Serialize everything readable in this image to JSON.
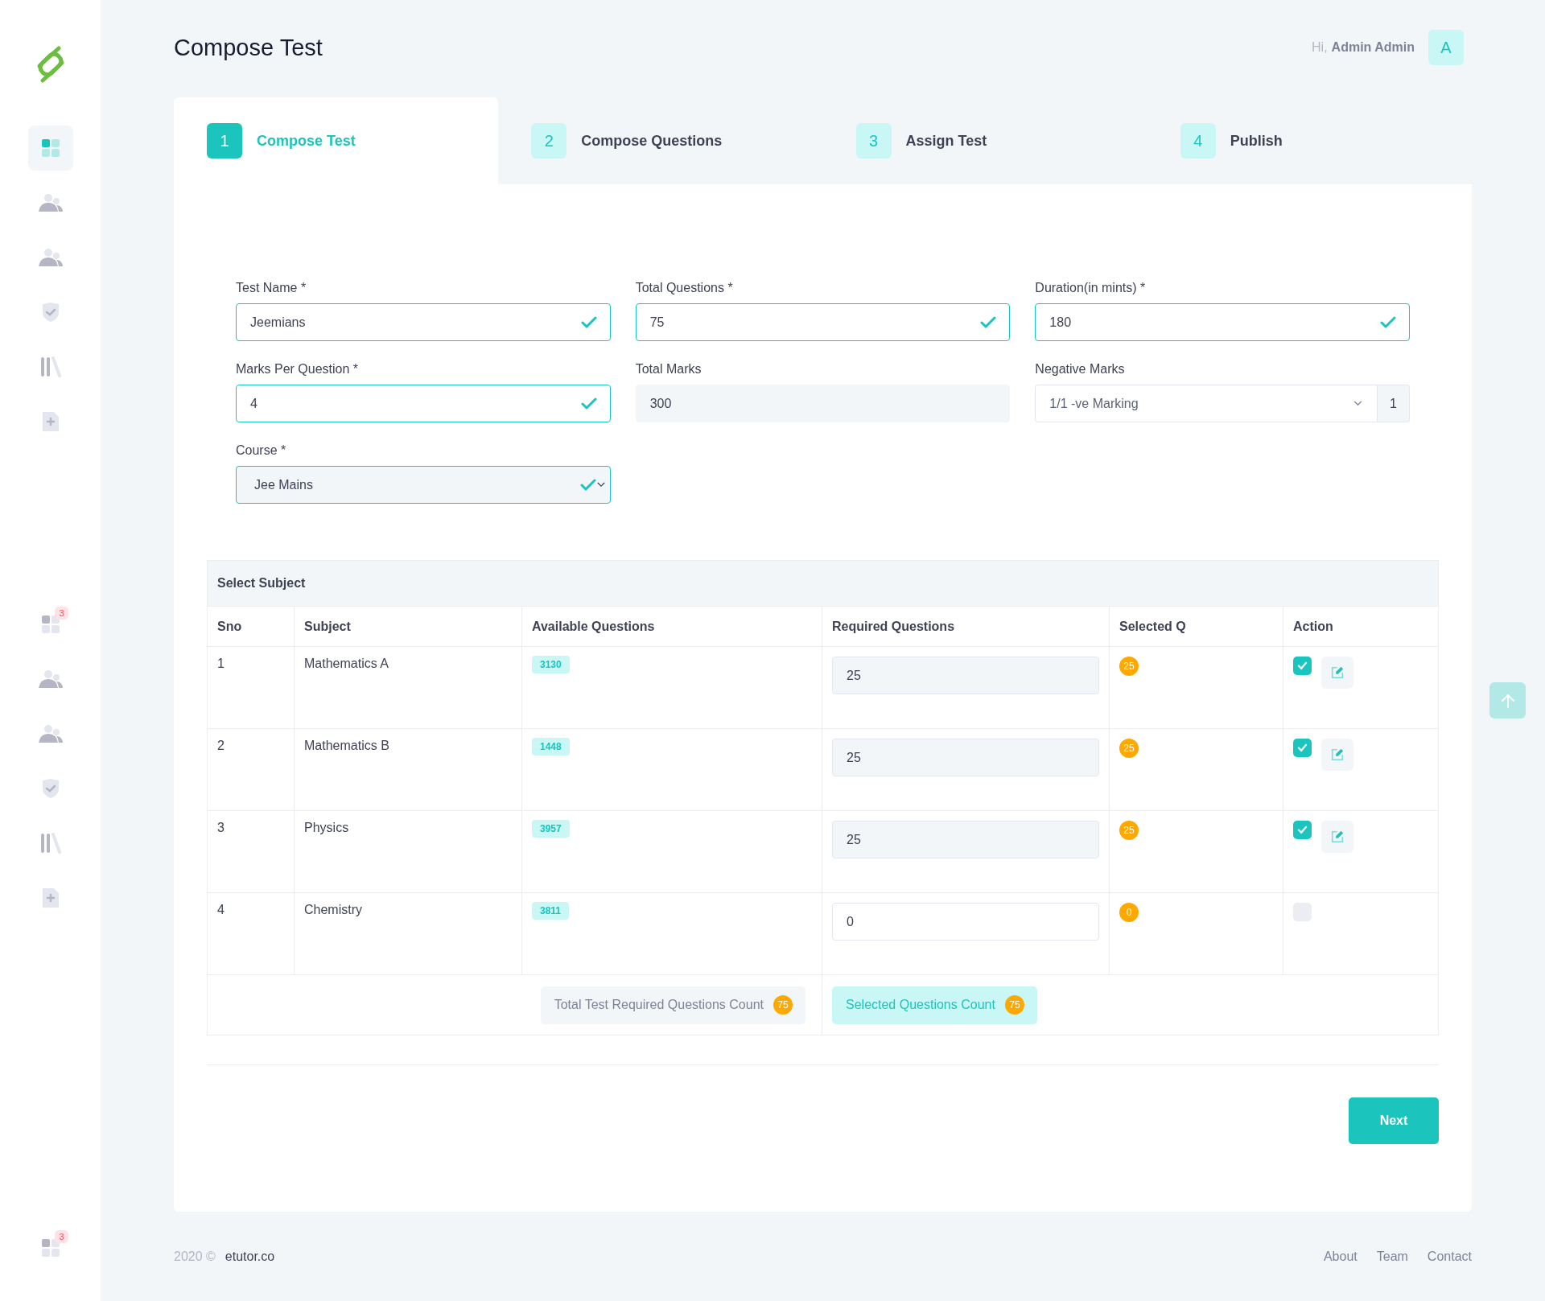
{
  "sidebar": {
    "items": [
      {
        "kind": "grid",
        "selected": true
      },
      {
        "kind": "people",
        "selected": false
      },
      {
        "kind": "people",
        "selected": false
      },
      {
        "kind": "shield",
        "selected": false
      },
      {
        "kind": "books",
        "selected": false
      },
      {
        "kind": "file-plus",
        "selected": false
      }
    ],
    "lower_items": [
      {
        "kind": "grid",
        "selected": false,
        "badge": "3"
      },
      {
        "kind": "people",
        "selected": false
      },
      {
        "kind": "people",
        "selected": false
      },
      {
        "kind": "shield",
        "selected": false
      },
      {
        "kind": "books",
        "selected": false
      },
      {
        "kind": "file-plus",
        "selected": false
      }
    ],
    "bottom_items": [
      {
        "kind": "grid",
        "selected": false,
        "badge": "3"
      }
    ]
  },
  "header": {
    "title": "Compose Test",
    "greeting": "Hi,",
    "user_name": "Admin Admin",
    "avatar": "A"
  },
  "steps": [
    {
      "number": "1",
      "label": "Compose Test",
      "selected": true
    },
    {
      "number": "2",
      "label": "Compose Questions",
      "selected": false
    },
    {
      "number": "3",
      "label": "Assign Test",
      "selected": false
    },
    {
      "number": "4",
      "label": "Publish",
      "selected": false
    }
  ],
  "form": {
    "fields": [
      {
        "kind": "text",
        "label": "Test Name *",
        "value": "Jeemians",
        "valid": true
      },
      {
        "kind": "text",
        "label": "Total Questions *",
        "value": "75",
        "valid": true
      },
      {
        "kind": "text",
        "label": "Duration(in mints) *",
        "value": "180",
        "valid": true
      },
      {
        "kind": "text",
        "label": "Marks Per Question *",
        "value": "4",
        "valid": true
      },
      {
        "kind": "readonly",
        "label": "Total Marks",
        "value": "300"
      },
      {
        "kind": "select_addon",
        "label": "Negative Marks",
        "value": "1/1 -ve Marking",
        "addon": "1"
      },
      {
        "kind": "select",
        "label": "Course *",
        "value": "Jee Mains",
        "valid": true
      }
    ]
  },
  "table": {
    "title": "Select Subject",
    "columns": [
      "Sno",
      "Subject",
      "Available Questions",
      "Required Questions",
      "Selected Q",
      "Action"
    ],
    "rows": [
      {
        "sno": "1",
        "subject": "Mathematics A",
        "available": "3130",
        "required": "25",
        "required_disabled": true,
        "selected_q": "25",
        "checked": true
      },
      {
        "sno": "2",
        "subject": "Mathematics B",
        "available": "1448",
        "required": "25",
        "required_disabled": true,
        "selected_q": "25",
        "checked": true
      },
      {
        "sno": "3",
        "subject": "Physics",
        "available": "3957",
        "required": "25",
        "required_disabled": true,
        "selected_q": "25",
        "checked": true
      },
      {
        "sno": "4",
        "subject": "Chemistry",
        "available": "3811",
        "required": "0",
        "required_disabled": false,
        "selected_q": "0",
        "checked": false
      }
    ],
    "totals": {
      "required_label": "Total Test Required Questions Count",
      "required_count": "75",
      "selected_label": "Selected Questions Count",
      "selected_count": "75"
    }
  },
  "next_button": "Next",
  "footer": {
    "year": "2020 ©",
    "brand": "etutor.co",
    "links": [
      "About",
      "Team",
      "Contact"
    ]
  }
}
